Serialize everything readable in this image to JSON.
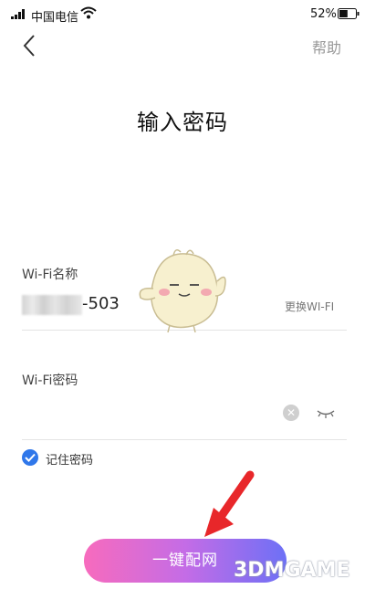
{
  "status_bar": {
    "carrier": "中国电信",
    "battery_percent": "52%",
    "battery_level": 0.52
  },
  "nav": {
    "back_icon": "chevron-left-icon",
    "help_label": "帮助"
  },
  "title": "输入密码",
  "wifi_name": {
    "label": "Wi-Fi名称",
    "value_suffix": "-503",
    "change_label": "更换WI-FI"
  },
  "wifi_password": {
    "label": "Wi-Fi密码",
    "value": "",
    "clear_icon": "clear-icon",
    "toggle_icon": "eye-closed-icon"
  },
  "remember": {
    "label": "记住密码",
    "checked": true
  },
  "primary_button": {
    "label": "一键配网"
  },
  "watermark": "3DMGAME",
  "colors": {
    "accent": "#2f77ea",
    "button_gradient_start": "#f76bbd",
    "button_gradient_end": "#6d70f6",
    "annotation_arrow": "#e8272a"
  }
}
